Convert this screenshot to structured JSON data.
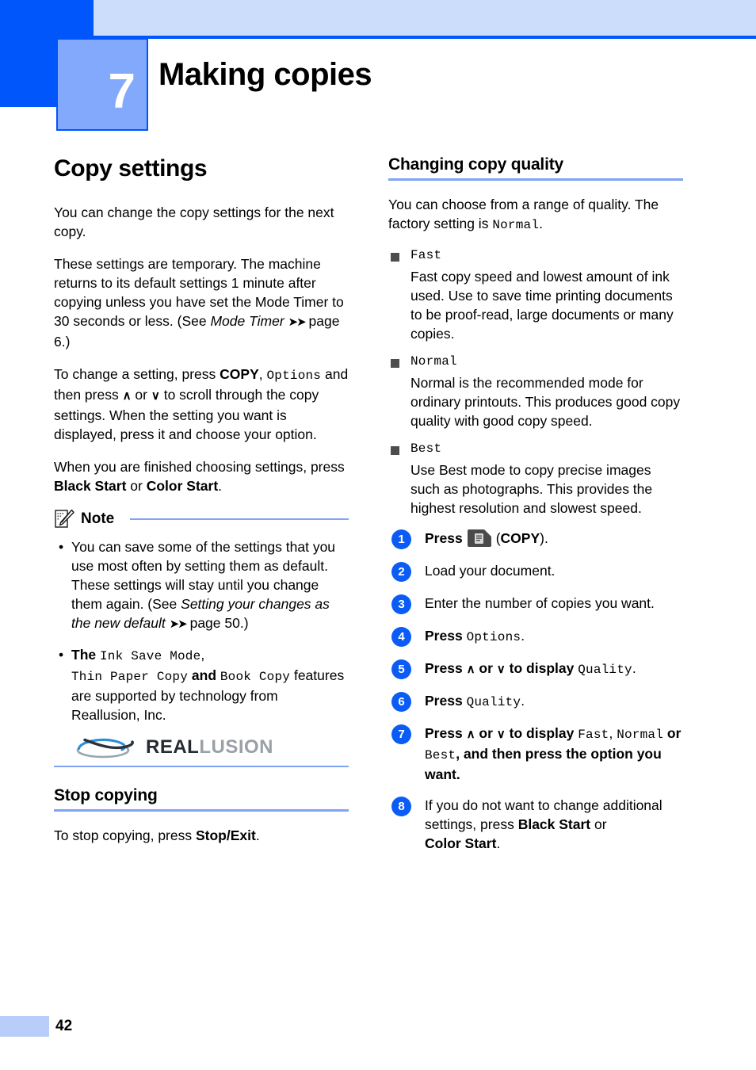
{
  "chapter": {
    "number": "7",
    "title": "Making copies"
  },
  "colors": {
    "header_dark_blue": "#0055fb",
    "header_light_blue": "#ccdcfb",
    "chapter_box_blue": "#82a9fb",
    "heading_rule_blue": "#7fa3f5",
    "step_circle_blue": "#0a5cf5",
    "bullet_square_gray": "#4d4d4d",
    "footer_tab_blue": "#b9cdfb",
    "logo_real_dark": "#262b33",
    "logo_lusion_gray": "#9aa0a8"
  },
  "left_column": {
    "heading": "Copy settings",
    "paragraph_1": "You can change the copy settings for the next copy.",
    "paragraph_2_a": "These settings are temporary. The machine returns to its default settings 1 minute after copying unless you have set the Mode Timer to 30 seconds or less. (See ",
    "paragraph_2_italic": "Mode Timer",
    "paragraph_2_arrow": "➤➤",
    "paragraph_2_b": " page 6.)",
    "paragraph_3_a": "To change a setting, press ",
    "paragraph_3_bold": "COPY",
    "paragraph_3_b": ", ",
    "paragraph_3_mono": "Options",
    "paragraph_3_c": " and then press ",
    "paragraph_3_up": "∧",
    "paragraph_3_d": " or ",
    "paragraph_3_down": "∨",
    "paragraph_3_e": " to scroll through the copy settings. When the setting you want is displayed, press it and choose your option.",
    "paragraph_4_a": "When you are finished choosing settings, press ",
    "paragraph_4_bold1": "Black Start",
    "paragraph_4_b": " or ",
    "paragraph_4_bold2": "Color Start",
    "paragraph_4_c": ".",
    "note": {
      "label": "Note",
      "icon": "note-pencil-icon",
      "bullet_1_a": "You can save some of the settings that you use most often by setting them as default. These settings will stay until you change them again. (See ",
      "bullet_1_italic": "Setting your changes as the new default",
      "bullet_1_arrow": "➤➤",
      "bullet_1_b": " page 50.)",
      "bullet_2_a": "The ",
      "bullet_2_mono1": "Ink Save Mode",
      "bullet_2_b": ", ",
      "bullet_2_mono2": "Thin Paper Copy",
      "bullet_2_c": " and ",
      "bullet_2_mono3": "Book Copy",
      "bullet_2_d": " features are supported by technology from Reallusion, Inc."
    },
    "logo": {
      "mark": "reallusion-swoosh-icon",
      "word_first": "REAL",
      "word_second": "LUSION"
    },
    "heading_2": "Stop copying",
    "stop_copying_a": "To stop copying, press ",
    "stop_copying_bold": "Stop/Exit",
    "stop_copying_b": "."
  },
  "right_column": {
    "heading": "Changing copy quality",
    "intro_a": "You can choose from a range of quality. The factory setting is ",
    "intro_mono": "Normal",
    "intro_b": ".",
    "quality_options": [
      {
        "term": "Fast",
        "description": "Fast copy speed and lowest amount of ink used. Use to save time printing documents to be proof-read, large documents or many copies."
      },
      {
        "term": "Normal",
        "description": "Normal is the recommended mode for ordinary printouts. This produces good copy quality with good copy speed."
      },
      {
        "term": "Best",
        "description": "Use Best mode to copy precise images such as photographs. This provides the highest resolution and slowest speed."
      }
    ],
    "steps": [
      {
        "num": "1",
        "bold_lead": "Press",
        "icon": "copy-key-icon",
        "text_after_icon_a": "(",
        "bold_mid": "COPY",
        "text_after_icon_b": ")."
      },
      {
        "num": "2",
        "text": "Load your document."
      },
      {
        "num": "3",
        "text": "Enter the number of copies you want."
      },
      {
        "num": "4",
        "bold_lead": "Press",
        "mono_1": "Options",
        "tail": "."
      },
      {
        "num": "5",
        "bold_lead": "Press",
        "up": "∧",
        "or": "or",
        "down": "∨",
        "mid": "to display",
        "mono_1": "Quality",
        "tail": "."
      },
      {
        "num": "6",
        "bold_lead": "Press",
        "mono_1": "Quality",
        "tail": "."
      },
      {
        "num": "7",
        "bold_lead": "Press",
        "up": "∧",
        "or": "or",
        "down": "∨",
        "mid": "to display",
        "mono_1": "Fast",
        "sep_1": ",",
        "mono_2": "Normal",
        "mid_2": "or",
        "mono_3": "Best",
        "tail": ", and then press the option you want."
      },
      {
        "num": "8",
        "text_a": "If you do not want to change additional settings, press ",
        "bold_1": "Black Start",
        "text_b": " or ",
        "bold_2": "Color Start",
        "text_c": "."
      }
    ]
  },
  "footer": {
    "page_number": "42"
  }
}
